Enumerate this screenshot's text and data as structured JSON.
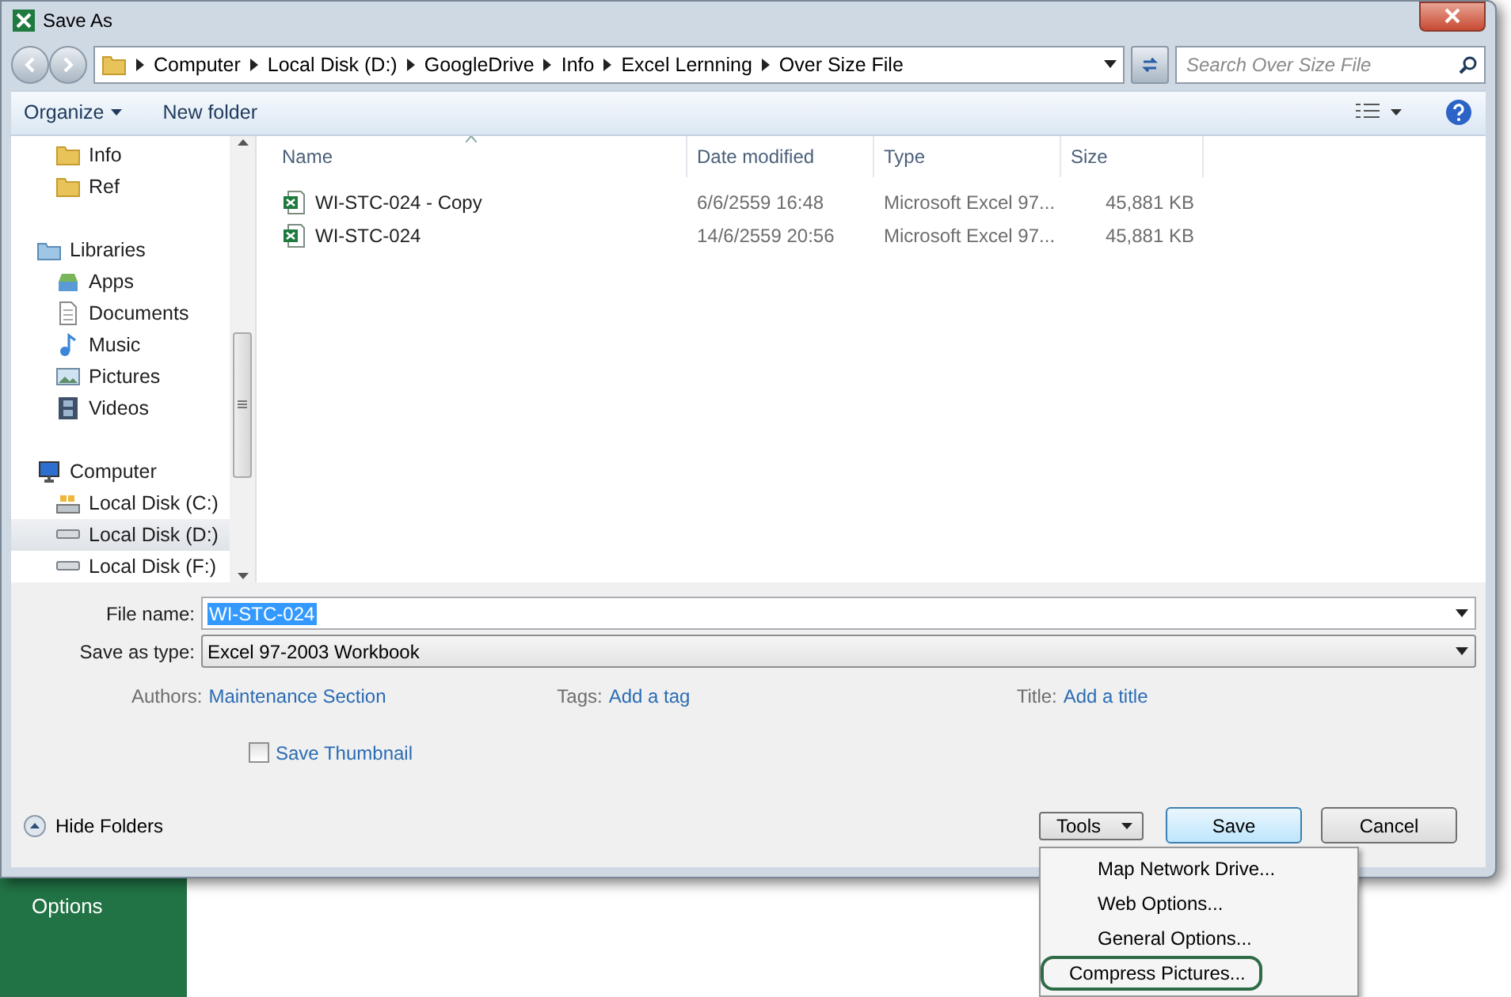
{
  "backstage": {
    "menu": [
      "Options"
    ]
  },
  "window": {
    "title": "Save As"
  },
  "address": {
    "segments": [
      "Computer",
      "Local Disk (D:)",
      "GoogleDrive",
      "Info",
      "Excel Lernning",
      "Over Size File"
    ]
  },
  "search": {
    "placeholder": "Search Over Size File"
  },
  "toolbar": {
    "organize": "Organize",
    "new_folder": "New folder"
  },
  "nav": [
    {
      "children": [
        {
          "label": "Info",
          "kind": "folder",
          "selected": false
        },
        {
          "label": "Ref",
          "kind": "folder",
          "selected": false
        }
      ]
    },
    {
      "label": "Libraries",
      "kind": "library",
      "selected": false,
      "children": [
        {
          "label": "Apps",
          "kind": "apps",
          "selected": false
        },
        {
          "label": "Documents",
          "kind": "document",
          "selected": false
        },
        {
          "label": "Music",
          "kind": "music",
          "selected": false
        },
        {
          "label": "Pictures",
          "kind": "pictures",
          "selected": false
        },
        {
          "label": "Videos",
          "kind": "videos",
          "selected": false
        }
      ]
    },
    {
      "label": "Computer",
      "kind": "computer",
      "selected": false,
      "children": [
        {
          "label": "Local Disk (C:)",
          "kind": "system-disk",
          "selected": false
        },
        {
          "label": "Local Disk (D:)",
          "kind": "disk",
          "selected": true
        },
        {
          "label": "Local Disk (F:)",
          "kind": "disk",
          "selected": false
        }
      ]
    }
  ],
  "table": {
    "columns": [
      "Name",
      "Date modified",
      "Type",
      "Size"
    ],
    "rows": [
      {
        "name": "WI-STC-024 - Copy",
        "date": "6/6/2559 16:48",
        "type": "Microsoft Excel 97...",
        "size": "45,881 KB"
      },
      {
        "name": "WI-STC-024",
        "date": "14/6/2559 20:56",
        "type": "Microsoft Excel 97...",
        "size": "45,881 KB"
      }
    ]
  },
  "form": {
    "file_name": {
      "label": "File name:",
      "value": "WI-STC-024"
    },
    "save_as_type": {
      "label": "Save as type:",
      "value": "Excel 97-2003 Workbook"
    },
    "meta": [
      {
        "label": "Authors:",
        "value": "Maintenance Section"
      },
      {
        "label": "Tags:",
        "value": "Add a tag"
      },
      {
        "label": "Title:",
        "value": "Add a title"
      }
    ],
    "thumbnail": {
      "label": "Save Thumbnail",
      "checked": false
    }
  },
  "footer": {
    "hide_folders": "Hide Folders",
    "tools": "Tools",
    "save": "Save",
    "cancel": "Cancel"
  },
  "tools_menu": [
    {
      "label": "Map Network Drive...",
      "highlighted": false
    },
    {
      "label": "Web Options...",
      "highlighted": false
    },
    {
      "label": "General Options...",
      "highlighted": false
    },
    {
      "label": "Compress Pictures...",
      "highlighted": true
    }
  ]
}
